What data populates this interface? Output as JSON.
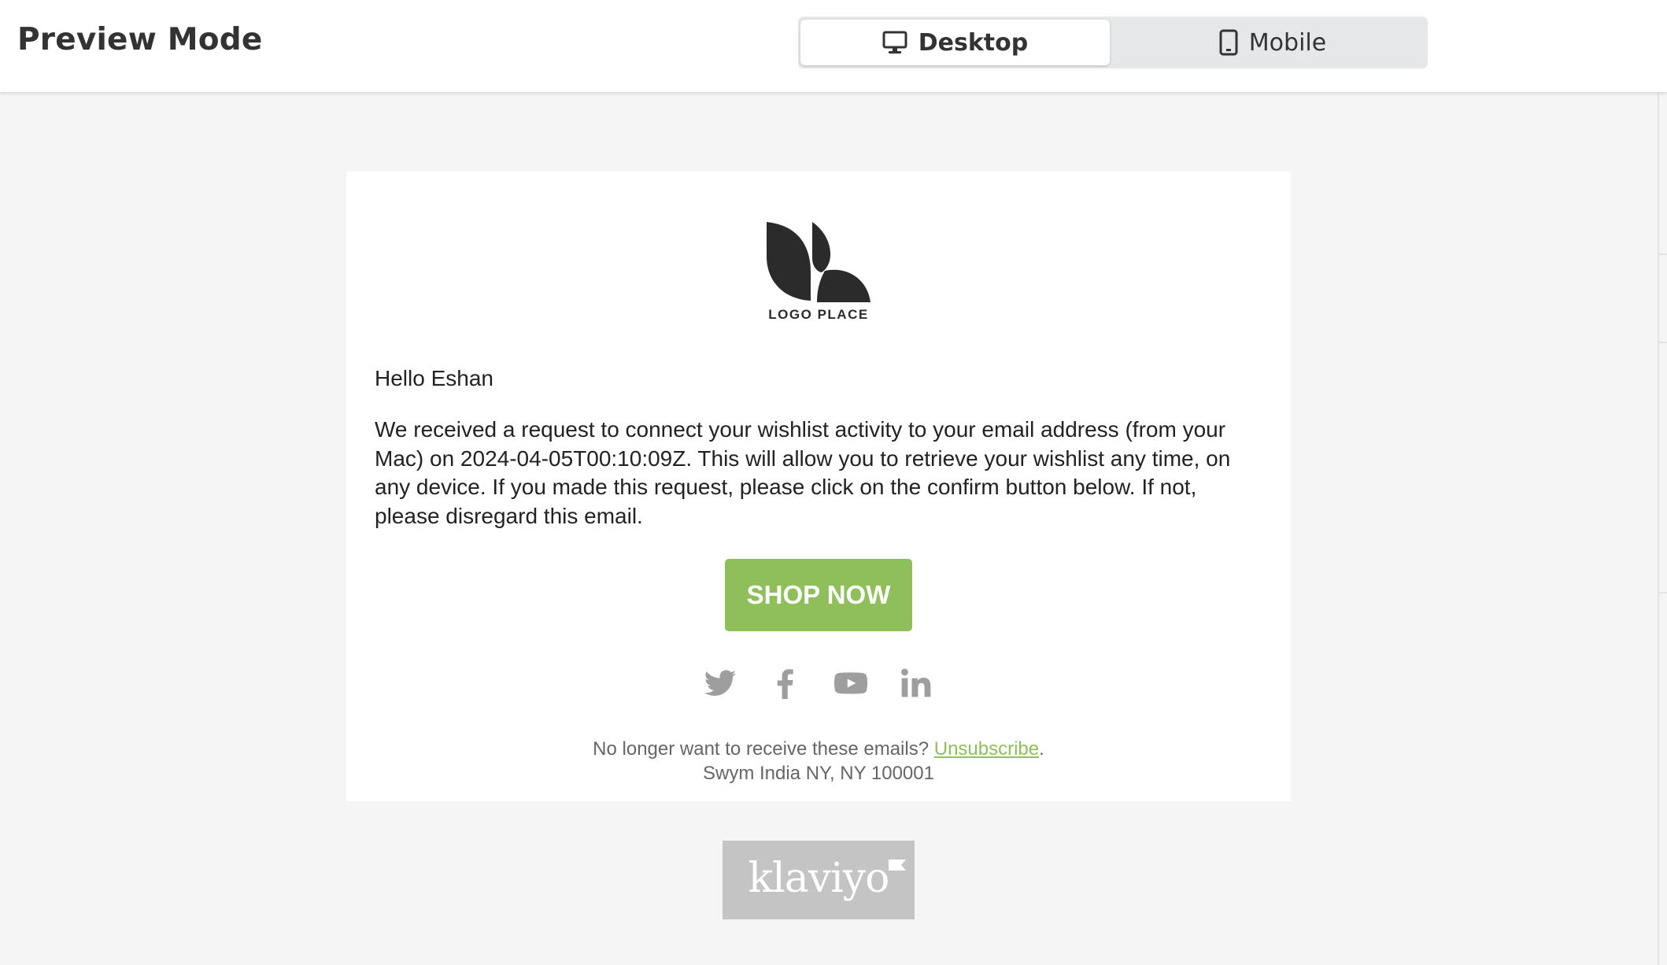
{
  "header": {
    "title": "Preview Mode",
    "tabs": [
      {
        "label": "Desktop",
        "icon": "desktop-icon",
        "selected": true
      },
      {
        "label": "Mobile",
        "icon": "mobile-icon",
        "selected": false
      }
    ]
  },
  "email": {
    "logo": {
      "text": "LOGO PLACE"
    },
    "greeting": "Hello Eshan",
    "body": "We received a request to connect your wishlist activity to your email address (from your Mac) on 2024-04-05T00:10:09Z. This will allow you to retrieve your wishlist any time, on any device. If you made this request, please click on the confirm button below. If not, please disregard this email.",
    "cta_label": "SHOP NOW",
    "social_icons": [
      "twitter-icon",
      "facebook-icon",
      "youtube-icon",
      "linkedin-icon"
    ],
    "footer": {
      "unsubscribe_prefix": "No longer want to receive these emails? ",
      "unsubscribe_link": "Unsubscribe",
      "unsubscribe_suffix": ".",
      "address": "Swym India NY, NY 100001"
    }
  },
  "badge": {
    "text": "klaviyo"
  },
  "colors": {
    "cta": "#8fbf5a",
    "link": "#8fbf5a",
    "social_icon": "#9e9e9e",
    "badge_bg": "#c4c4c4"
  }
}
